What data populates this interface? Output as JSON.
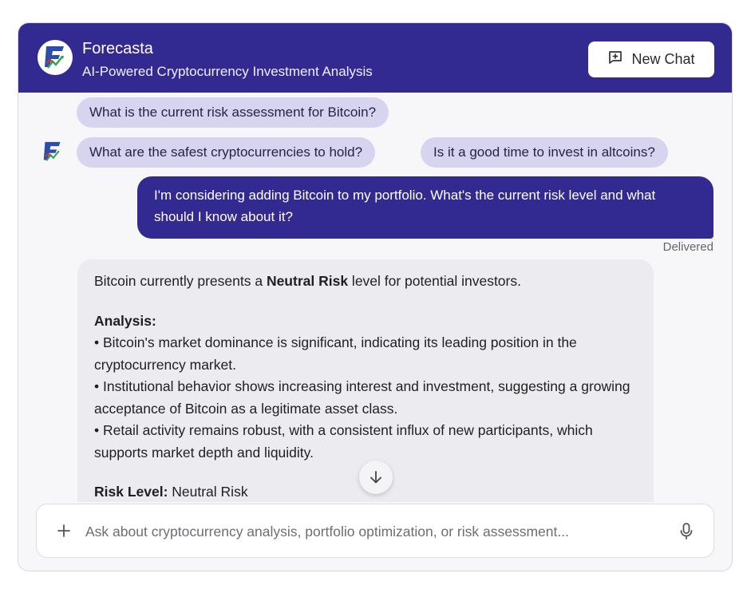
{
  "header": {
    "app_name": "Forecasta",
    "subtitle": "AI-Powered Cryptocurrency Investment Analysis",
    "new_chat_label": "New Chat"
  },
  "suggestions": [
    {
      "label": "What is the current risk assessment for Bitcoin?"
    },
    {
      "label": "What are the safest cryptocurrencies to hold?"
    },
    {
      "label": "Is it a good time to invest in altcoins?"
    }
  ],
  "messages": {
    "user": {
      "text": "I'm considering adding Bitcoin to my portfolio. What's the current risk level and what should I know about it?",
      "status": "Delivered"
    },
    "bot": {
      "intro_prefix": "Bitcoin currently presents a ",
      "intro_bold": "Neutral Risk",
      "intro_suffix": " level for potential investors.",
      "analysis_heading": "Analysis:",
      "bullets": [
        "• Bitcoin's market dominance is significant, indicating its leading position in the cryptocurrency market.",
        "• Institutional behavior shows increasing interest and investment, suggesting a growing acceptance of Bitcoin as a legitimate asset class.",
        "• Retail activity remains robust, with a consistent influx of new participants, which supports market depth and liquidity."
      ],
      "risk_label": "Risk Level:",
      "risk_value": " Neutral Risk"
    }
  },
  "composer": {
    "placeholder": "Ask about cryptocurrency analysis, portfolio optimization, or risk assessment..."
  },
  "colors": {
    "brand": "#332a91",
    "chip": "#d7d4ef",
    "bot_bubble": "#ececf0"
  },
  "icons": [
    "forecasta-logo-icon",
    "new-chat-icon",
    "arrow-down-icon",
    "plus-icon",
    "microphone-icon"
  ]
}
